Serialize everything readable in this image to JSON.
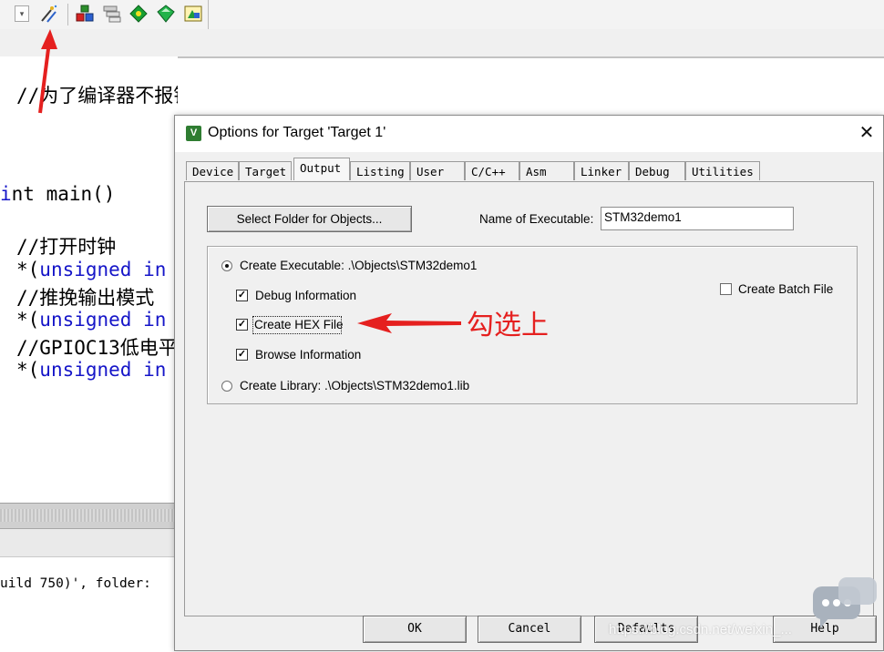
{
  "toolbar": {
    "icons": [
      "dropdown-arrow-icon",
      "magic-wand-icon",
      "pack-installer-icon",
      "manage-components-icon",
      "green-diamond-icon",
      "green-up-icon",
      "pack-tools-icon"
    ]
  },
  "editor": {
    "lines": [
      {
        "text": "//为了编译器不报错",
        "color": "green"
      },
      {
        "text": "nt main()",
        "color": "black"
      },
      {
        "text": "//打开时钟",
        "color": "green"
      },
      {
        "prefix": "*(",
        "kw": "unsigned in",
        "color": "blue"
      },
      {
        "text": "//推挽输出模式",
        "color": "green"
      },
      {
        "prefix": "*(",
        "kw": "unsigned in",
        "color": "blue"
      },
      {
        "text": "//GPIOC13低电平",
        "color": "green"
      },
      {
        "prefix": "*(",
        "kw": "unsigned in",
        "color": "blue"
      }
    ]
  },
  "build_output": {
    "text": "uild 750)', folder: "
  },
  "dialog": {
    "title": "Options for Target 'Target 1'",
    "tabs": [
      "Device",
      "Target",
      "Output",
      "Listing",
      "User",
      "C/C++",
      "Asm",
      "Linker",
      "Debug",
      "Utilities"
    ],
    "active_tab": "Output",
    "select_folder_label": "Select Folder for Objects...",
    "name_exec_label": "Name of Executable:",
    "name_exec_value": "STM32demo1",
    "create_exec_label": "Create Executable:  .\\Objects\\STM32demo1",
    "debug_info_label": "Debug Information",
    "create_hex_label": "Create HEX File",
    "browse_info_label": "Browse Information",
    "create_lib_label": "Create Library:  .\\Objects\\STM32demo1.lib",
    "create_batch_label": "Create Batch File",
    "debug_info_checked": true,
    "create_hex_checked": true,
    "browse_info_checked": true,
    "create_batch_checked": false,
    "create_exec_selected": true,
    "ok_label": "OK",
    "cancel_label": "Cancel",
    "defaults_label": "Defaults",
    "help_label": "Help"
  },
  "annotation": {
    "text": "勾选上",
    "color": "#e5201f"
  },
  "watermark": {
    "text": "https://blog.csdn.net/weixin_..."
  }
}
